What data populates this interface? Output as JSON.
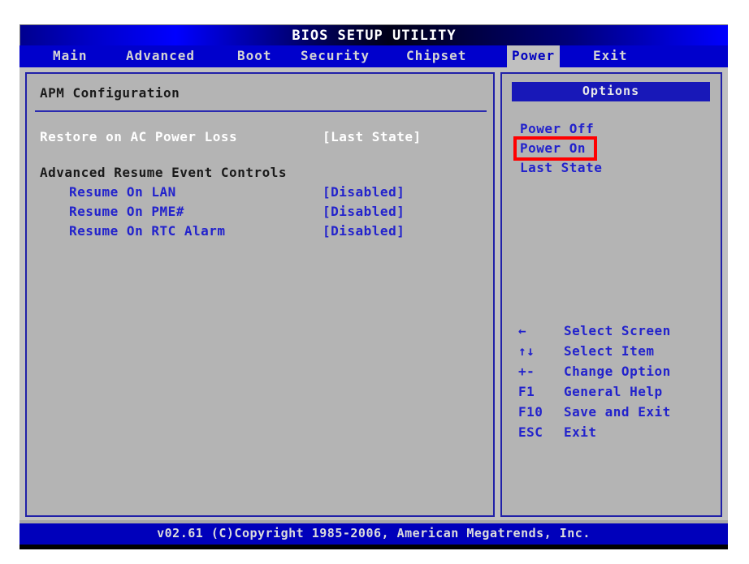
{
  "window": {
    "title": "BIOS SETUP UTILITY",
    "footer": "v02.61 (C)Copyright 1985-2006, American Megatrends, Inc."
  },
  "tabs": [
    {
      "label": "Main",
      "active": false
    },
    {
      "label": "Advanced",
      "active": false
    },
    {
      "label": "Boot",
      "active": false
    },
    {
      "label": "Security",
      "active": false
    },
    {
      "label": "Chipset",
      "active": false
    },
    {
      "label": "Power",
      "active": true
    },
    {
      "label": "Exit",
      "active": false
    }
  ],
  "main_panel": {
    "title": "APM Configuration",
    "rows": [
      {
        "label": "Restore on AC Power Loss",
        "value": "[Last State]",
        "style": "selected",
        "indent": false
      },
      {
        "label": "Advanced Resume Event Controls",
        "value": "",
        "style": "head",
        "indent": false
      },
      {
        "label": "Resume On LAN",
        "value": "[Disabled]",
        "style": "blue",
        "indent": true
      },
      {
        "label": "Resume On PME#",
        "value": "[Disabled]",
        "style": "blue",
        "indent": true
      },
      {
        "label": "Resume On RTC Alarm",
        "value": "[Disabled]",
        "style": "blue",
        "indent": true
      }
    ]
  },
  "options_panel": {
    "header": "Options",
    "items": [
      {
        "label": "Power Off",
        "highlighted": false
      },
      {
        "label": "Power On",
        "highlighted": true
      },
      {
        "label": "Last State",
        "highlighted": false
      }
    ],
    "nav_help": [
      {
        "key": "←",
        "desc": "Select Screen"
      },
      {
        "key": "↑↓",
        "desc": "Select Item"
      },
      {
        "key": "+-",
        "desc": "Change Option"
      },
      {
        "key": "F1",
        "desc": "General Help"
      },
      {
        "key": "F10",
        "desc": "Save and Exit"
      },
      {
        "key": "ESC",
        "desc": "Exit"
      }
    ]
  },
  "colors": {
    "accent_blue": "#2222cc",
    "panel_bg": "#b4b4b4",
    "highlight_red": "#ff0000",
    "title_gradient_blue": "#0000ff"
  }
}
